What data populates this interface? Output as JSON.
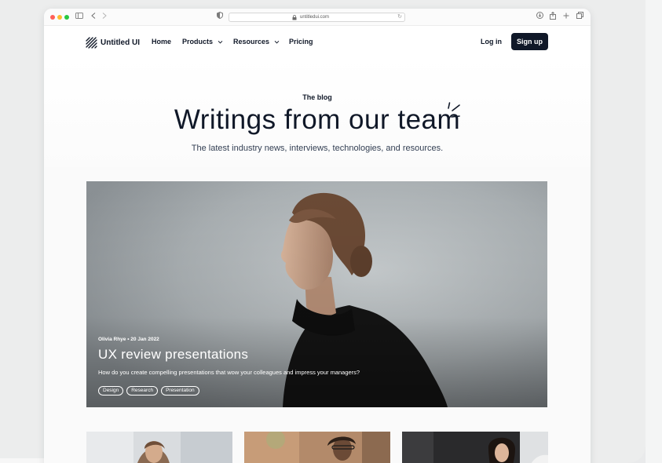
{
  "browser": {
    "url": "untitledui.com"
  },
  "brand": {
    "name": "Untitled UI",
    "logo_icon": "diagonal-stripes-logo-icon"
  },
  "nav": {
    "items": [
      {
        "label": "Home"
      },
      {
        "label": "Products"
      },
      {
        "label": "Resources"
      },
      {
        "label": "Pricing"
      }
    ],
    "login_label": "Log in",
    "signup_label": "Sign up"
  },
  "hero": {
    "eyebrow": "The blog",
    "title": "Writings from our team",
    "subtitle": "The latest industry news, interviews, technologies, and resources."
  },
  "featured_post": {
    "meta": "Olivia Rhye • 20 Jan 2022",
    "title": "UX review presentations",
    "excerpt": "How do you create compelling presentations that wow your colleagues and impress your managers?",
    "tags": [
      "Design",
      "Research",
      "Presentation"
    ]
  },
  "colors": {
    "primary": "#101828",
    "text_secondary": "#344054",
    "background": "#ffffff"
  }
}
